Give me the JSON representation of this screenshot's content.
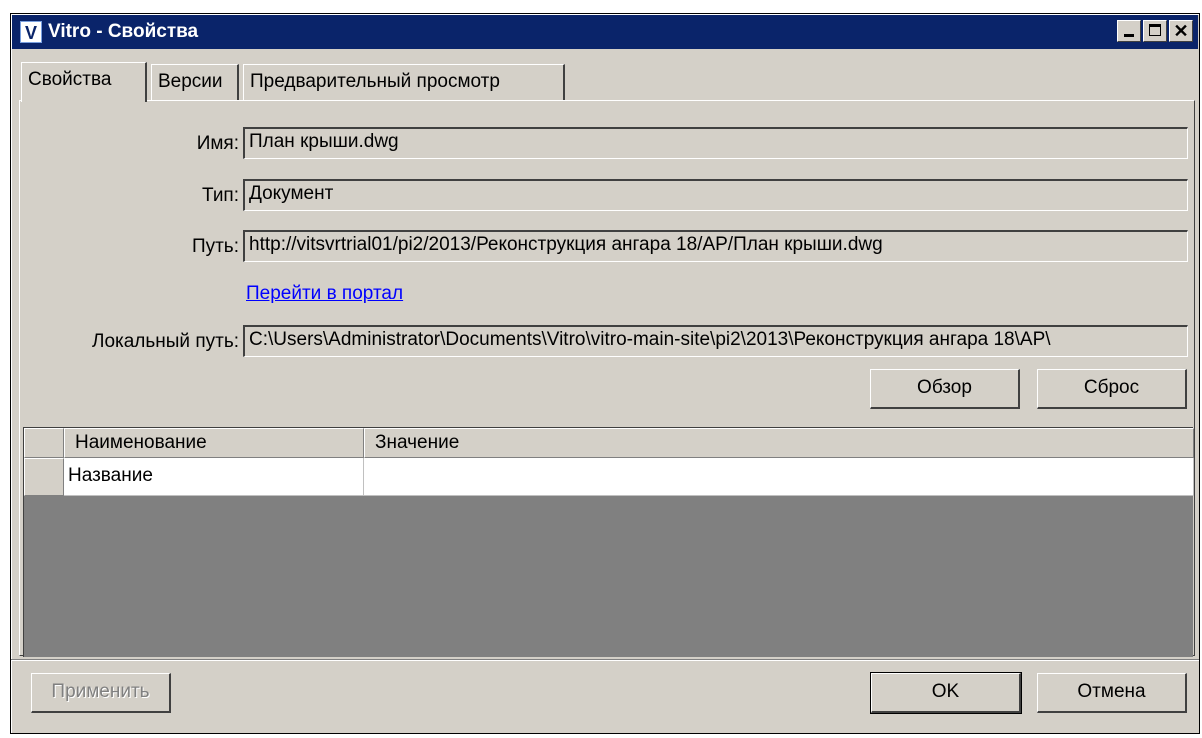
{
  "window": {
    "app_icon": "V",
    "title": "Vitro - Свойства",
    "close_glyph": "✕"
  },
  "tabs": [
    {
      "label": "Свойства",
      "active": true
    },
    {
      "label": "Версии",
      "active": false
    },
    {
      "label": "Предварительный просмотр",
      "active": false
    }
  ],
  "form": {
    "name_label": "Имя:",
    "name_value": "План крыши.dwg",
    "type_label": "Тип:",
    "type_value": "Документ",
    "path_label": "Путь:",
    "path_value": "http://vitsvrtrial01/pi2/2013/Реконструкция ангара 18/AP/План крыши.dwg",
    "portal_link": "Перейти в портал",
    "local_path_label": "Локальный путь:",
    "local_path_value": "C:\\Users\\Administrator\\Documents\\Vitro\\vitro-main-site\\pi2\\2013\\Реконструкция ангара 18\\AP\\",
    "browse_button": "Обзор",
    "reset_button": "Сброс"
  },
  "grid": {
    "columns": [
      "Наименование",
      "Значение"
    ],
    "rows": [
      {
        "name": "Название",
        "value": ""
      }
    ]
  },
  "footer": {
    "apply_button": "Применить",
    "ok_button": "OK",
    "cancel_button": "Отмена"
  }
}
